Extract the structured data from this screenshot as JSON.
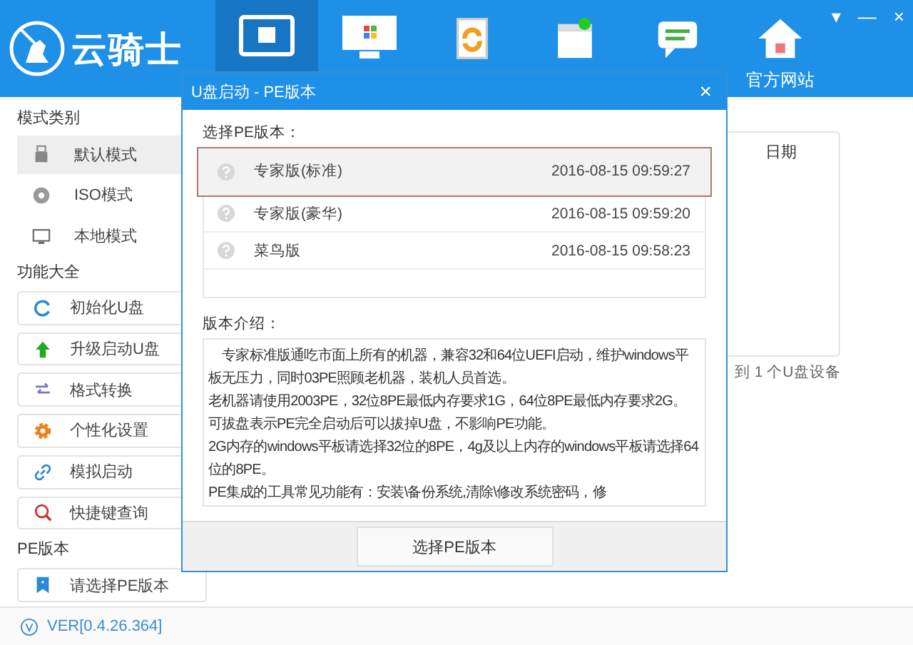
{
  "app": {
    "logo_text": "云骑士",
    "window_controls": [
      "▾",
      "—",
      "×"
    ]
  },
  "nav_tabs": [
    {
      "selected": true
    },
    {
      "selected": false
    },
    {
      "selected": false
    },
    {
      "selected": false
    },
    {
      "selected": false
    },
    {
      "label": "官方网站",
      "selected": false
    }
  ],
  "sidebar": {
    "sections": [
      {
        "title": "模式类别",
        "kind": "mode",
        "items": [
          {
            "label": "默认模式",
            "selected": true
          },
          {
            "label": "ISO模式",
            "selected": false
          },
          {
            "label": "本地模式",
            "selected": false
          }
        ]
      },
      {
        "title": "功能大全",
        "kind": "button",
        "items": [
          {
            "label": "初始化U盘"
          },
          {
            "label": "升级启动U盘"
          },
          {
            "label": "格式转换"
          },
          {
            "label": "个性化设置"
          },
          {
            "label": "模拟启动"
          },
          {
            "label": "快捷键查询"
          }
        ]
      },
      {
        "title": "PE版本",
        "kind": "button",
        "items": [
          {
            "label": "请选择PE版本"
          }
        ]
      }
    ]
  },
  "background": {
    "column_header": "日期",
    "device_status": "到 1 个U盘设备"
  },
  "version": "VER[0.4.26.364]",
  "dialog": {
    "title": "U盘启动 - PE版本",
    "close": "×",
    "select_label": "选择PE版本：",
    "versions": [
      {
        "name": "专家版(标准)",
        "date": "2016-08-15 09:59:27",
        "selected": true
      },
      {
        "name": "专家版(豪华)",
        "date": "2016-08-15 09:59:20",
        "selected": false
      },
      {
        "name": "菜鸟版",
        "date": "2016-08-15 09:58:23",
        "selected": false
      }
    ],
    "intro_label": "版本介绍：",
    "intro_lines": [
      "　专家标准版通吃市面上所有的机器，兼容32和64位UEFI启动，维护windows平板无压力，同时03PE照顾老机器，装机人员首选。",
      "老机器请使用2003PE，32位8PE最低内存要求1G，64位8PE最低内存要求2G。",
      "可拔盘表示PE完全启动后可以拔掉U盘，不影响PE功能。",
      "2G内存的windows平板请选择32位的8PE，4g及以上内存的windows平板请选择64位的8PE。",
      "PE集成的工具常见功能有：安装\\备份系统,清除\\修改系统密码，修"
    ],
    "confirm_button": "选择PE版本"
  }
}
